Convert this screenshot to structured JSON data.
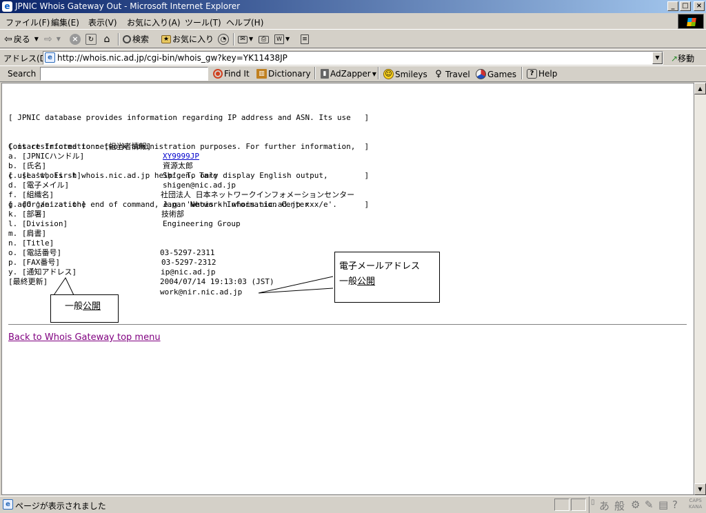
{
  "window": {
    "title": "JPNIC Whois Gateway Out - Microsoft Internet Explorer",
    "minimize": "_",
    "maximize": "□",
    "close": "×"
  },
  "menu": [
    "ファイル(F)",
    "編集(E)",
    "表示(V)",
    "お気に入り(A)",
    "ツール(T)",
    "ヘルプ(H)"
  ],
  "toolbar": {
    "back": "戻る",
    "search": "検索",
    "favorites": "お気に入り"
  },
  "address": {
    "label": "アドレス(D)",
    "url": "http://whois.nic.ad.jp/cgi-bin/whois_gw?key=YK11438JP",
    "go": "移動"
  },
  "links": {
    "search_label": "Search",
    "search_value": "",
    "items": [
      "Find It",
      "Dictionary",
      "AdZapper",
      "Smileys",
      "Travel",
      "Games",
      "Help"
    ]
  },
  "notice": [
    "[ JPNIC database provides information regarding IP address and ASN. Its use   ]",
    "[ is restricted to network administration purposes. For further information,  ]",
    "[ use 'whois -h whois.nic.ad.jp help'. To only display English output,        ]",
    "[ add '/e' at the end of command, e.g. 'whois -h whois.nic.ad.jp xxx/e'.      ]"
  ],
  "contact_title": "Contact Information: [担当者情報]",
  "fields": [
    {
      "label": "a. [JPNICハンドル]",
      "value": "XY9999JP"
    },
    {
      "label": "b. [氏名]",
      "value": "資源太郎"
    },
    {
      "label": "c. [Last, First]",
      "value": "Shigen, Taro"
    },
    {
      "label": "d. [電子メイル]",
      "value": "shigen@nic.ad.jp"
    },
    {
      "label": "f. [組織名]",
      "value": "社団法人 日本ネットワークインフォメーションセンター"
    },
    {
      "label": "g. [Organization]",
      "value": "Japan Network Information Center"
    },
    {
      "label": "k. [部署]",
      "value": "技術部"
    },
    {
      "label": "l. [Division]",
      "value": "Engineering Group"
    },
    {
      "label": "m. [肩書]",
      "value": ""
    },
    {
      "label": "n. [Title]",
      "value": ""
    },
    {
      "label": "o. [電話番号]",
      "value": "03-5297-2311"
    },
    {
      "label": "p. [FAX番号]",
      "value": "03-5297-2312"
    },
    {
      "label": "y. [通知アドレス]",
      "value": "ip@nic.ad.jp"
    },
    {
      "label": "[最終更新]",
      "value": "2004/07/14 19:13:03 (JST)"
    }
  ],
  "extra_email": "work@nir.nic.ad.jp",
  "back_link": "Back to Whois Gateway top menu",
  "callouts": {
    "left": {
      "line1_plain": "一般",
      "line1_underlined": "公開"
    },
    "right": {
      "line1": "電子メールアドレス",
      "line2_plain": "一般",
      "line2_underlined": "公開"
    }
  },
  "status": {
    "text": "ページが表示されました",
    "ime": [
      "あ",
      "般"
    ],
    "caps": "CAPS",
    "kana": "KANA"
  }
}
